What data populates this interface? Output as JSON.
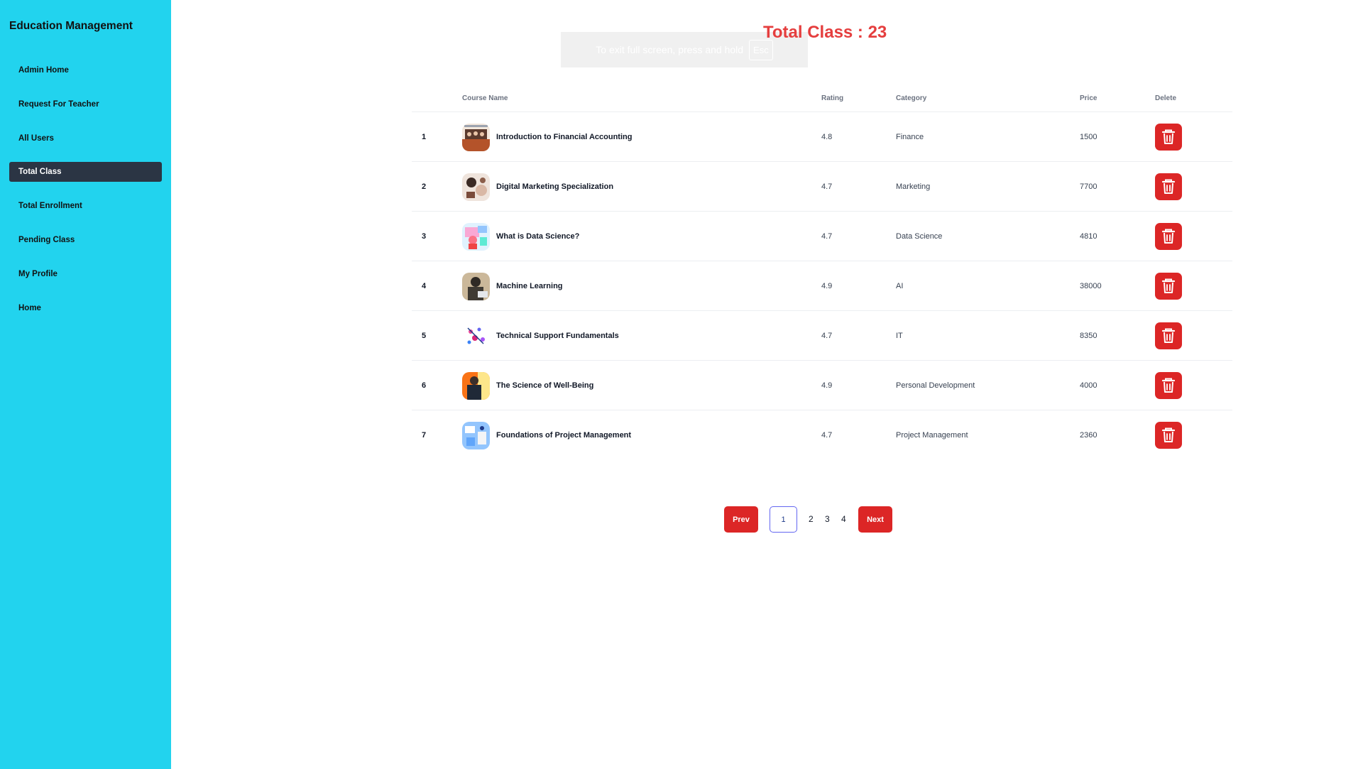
{
  "sidebar": {
    "brand": "Education Management",
    "items": [
      {
        "label": "Admin Home"
      },
      {
        "label": "Request For Teacher"
      },
      {
        "label": "All Users"
      },
      {
        "label": "Total Class"
      },
      {
        "label": "Total Enrollment"
      },
      {
        "label": "Pending Class"
      },
      {
        "label": "My Profile"
      },
      {
        "label": "Home"
      }
    ],
    "active": "Total Class"
  },
  "fullscreen_notice": {
    "text": "To exit full screen, press and hold",
    "key": "Esc"
  },
  "page": {
    "title": "Total Class : 23"
  },
  "table": {
    "headers": {
      "course": "Course Name",
      "rating": "Rating",
      "category": "Category",
      "price": "Price",
      "delete": "Delete"
    },
    "rows": [
      {
        "index": "1",
        "name": "Introduction to Financial Accounting",
        "rating": "4.8",
        "category": "Finance",
        "price": "1500",
        "thumb": "finance"
      },
      {
        "index": "2",
        "name": "Digital Marketing Specialization",
        "rating": "4.7",
        "category": "Marketing",
        "price": "7700",
        "thumb": "marketing"
      },
      {
        "index": "3",
        "name": "What is Data Science?",
        "rating": "4.7",
        "category": "Data Science",
        "price": "4810",
        "thumb": "datascience"
      },
      {
        "index": "4",
        "name": "Machine Learning",
        "rating": "4.9",
        "category": "AI",
        "price": "38000",
        "thumb": "ml"
      },
      {
        "index": "5",
        "name": "Technical Support Fundamentals",
        "rating": "4.7",
        "category": "IT",
        "price": "8350",
        "thumb": "it"
      },
      {
        "index": "6",
        "name": "The Science of Well-Being",
        "rating": "4.9",
        "category": "Personal Development",
        "price": "4000",
        "thumb": "wellbeing"
      },
      {
        "index": "7",
        "name": "Foundations of Project Management",
        "rating": "4.7",
        "category": "Project Management",
        "price": "2360",
        "thumb": "pm"
      }
    ]
  },
  "pagination": {
    "prev": "Prev",
    "current": "1",
    "pages": [
      "2",
      "3",
      "4"
    ],
    "next": "Next"
  },
  "colors": {
    "sidebar_bg": "#22d3ee",
    "active_item_bg": "#2b3544",
    "title_red": "#e53e3e",
    "delete_red": "#dc2626",
    "current_page_border": "#6366f1"
  }
}
